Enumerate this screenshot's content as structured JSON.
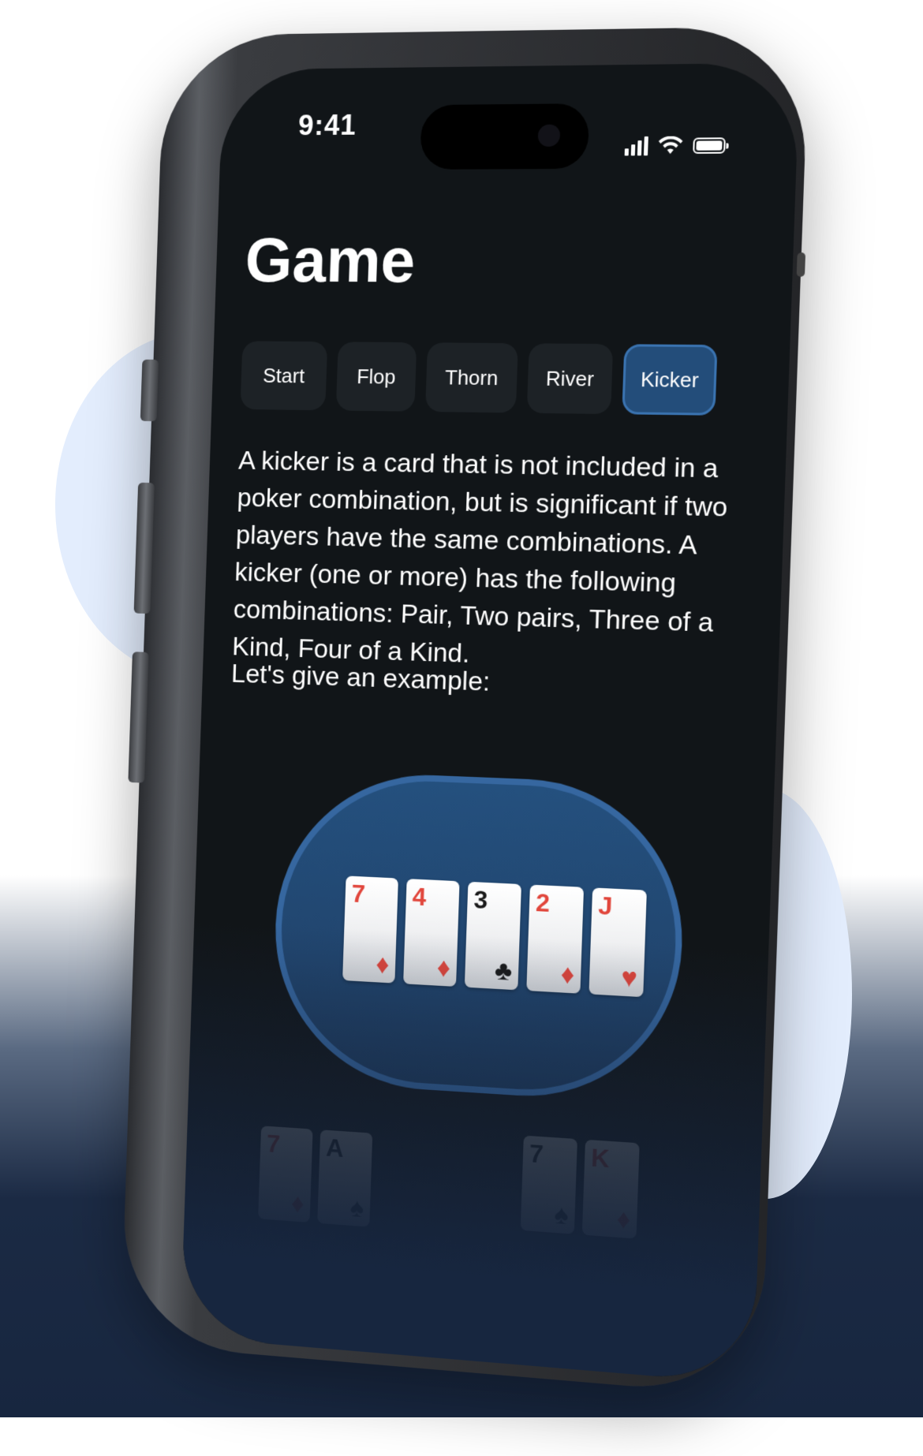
{
  "status_bar": {
    "time": "9:41"
  },
  "header": {
    "title": "Game"
  },
  "tabs": [
    {
      "label": "Start",
      "active": false
    },
    {
      "label": "Flop",
      "active": false
    },
    {
      "label": "Thorn",
      "active": false
    },
    {
      "label": "River",
      "active": false
    },
    {
      "label": "Kicker",
      "active": true
    }
  ],
  "content": {
    "description": "A kicker is a card that is not included in a poker combination, but is significant if two players have the same combinations. A kicker (one or more) has the following combinations: Pair, Two pairs, Three of a Kind, Four of a Kind.",
    "example_intro": "Let's give an example:"
  },
  "community_cards": [
    {
      "rank": "7",
      "suit": "♦",
      "color": "red"
    },
    {
      "rank": "4",
      "suit": "♦",
      "color": "red"
    },
    {
      "rank": "3",
      "suit": "♣",
      "color": "black"
    },
    {
      "rank": "2",
      "suit": "♦",
      "color": "red"
    },
    {
      "rank": "J",
      "suit": "♥",
      "color": "red"
    }
  ],
  "player_left_cards": [
    {
      "rank": "7",
      "suit": "♦",
      "color": "red"
    },
    {
      "rank": "A",
      "suit": "♠",
      "color": "black"
    }
  ],
  "player_right_cards": [
    {
      "rank": "7",
      "suit": "♠",
      "color": "black"
    },
    {
      "rank": "K",
      "suit": "♦",
      "color": "red"
    }
  ],
  "colors": {
    "accent": "#234d7a",
    "table": "#24507e",
    "screen": "#111518",
    "red_suit": "#e1463c"
  }
}
